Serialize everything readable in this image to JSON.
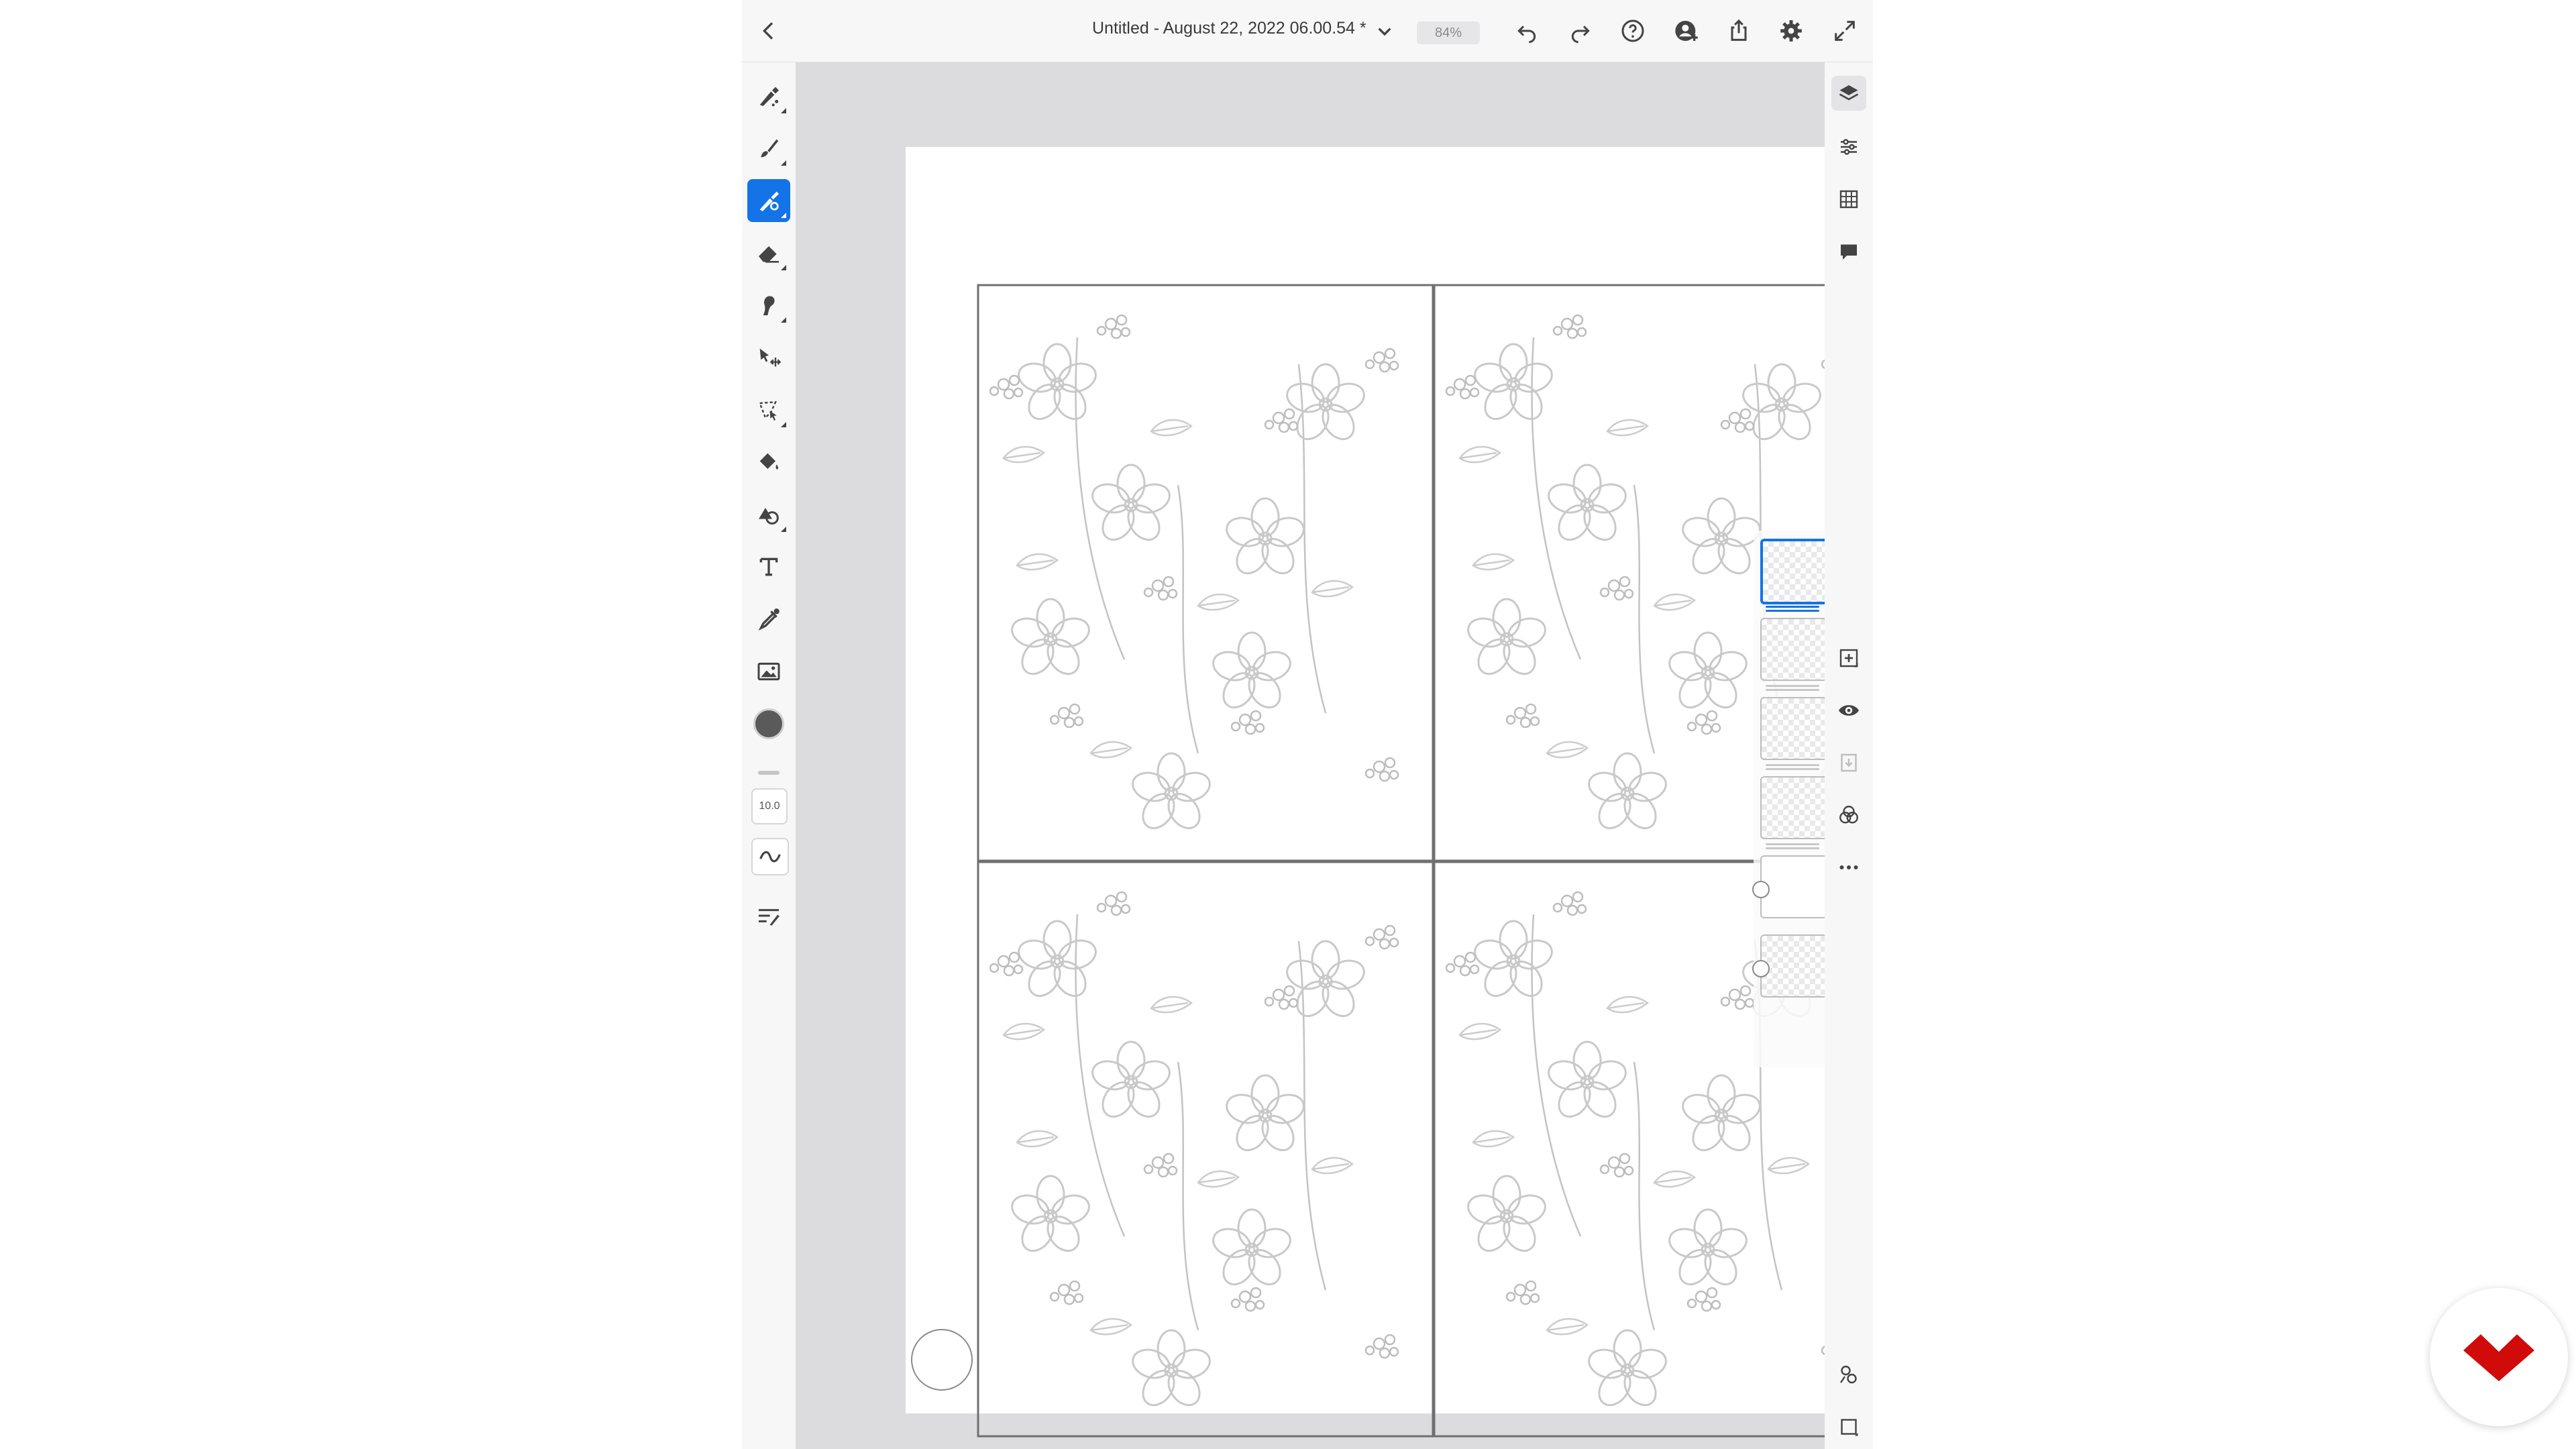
{
  "topbar": {
    "title": "Untitled - August 22, 2022 06.00.54 *",
    "zoom": "84%"
  },
  "toolbar": {
    "tools": [
      "pixel-brush",
      "live-brush",
      "vector-brush",
      "eraser",
      "smudge",
      "transform",
      "selection",
      "fill",
      "shapes",
      "text",
      "eyedropper",
      "image"
    ],
    "active_tool": "vector-brush",
    "brush_size": "10.0",
    "brush_color": "#5a5a5a"
  },
  "layers": {
    "count": 6,
    "selected_index": 0
  },
  "right_toolbar": {
    "tools": [
      "layers",
      "layer-properties",
      "grid",
      "comments",
      "add-layer",
      "visibility",
      "merge-down",
      "blend-mode",
      "more-options",
      "layer-effects",
      "expand-panel"
    ],
    "active": "layers"
  },
  "colors": {
    "accent": "#1473e6",
    "toolbar_bg": "#f7f7f8",
    "canvas_bg": "#dcdcde",
    "logo_red": "#d10a0a"
  }
}
